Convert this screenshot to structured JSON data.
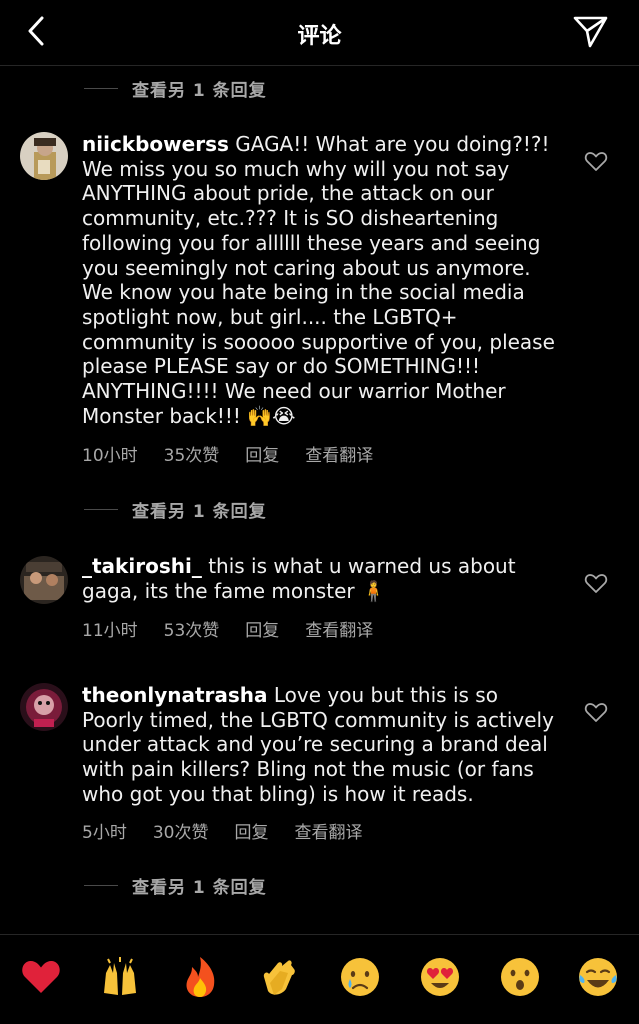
{
  "header": {
    "title": "评论"
  },
  "view_more_replies": "查看另 1 条回复",
  "comments": [
    {
      "username": "niickbowerss",
      "text": "GAGA!! What are you doing?!?! We miss you so much why will you not say ANYTHING about pride, the attack on our community, etc.??? It is SO disheartening following you for allllll these years and seeing you seemingly not caring about us anymore. We know you hate being in the social media spotlight now, but girl.... the LGBTQ+ community is sooooo supportive of you, please please PLEASE say or do SOMETHING!!! ANYTHING!!!! We need our warrior Mother Monster back!!! 🙌😭",
      "time": "10小时",
      "likes": "35次赞",
      "reply": "回复",
      "translate": "查看翻译"
    },
    {
      "username": "_takiroshi_",
      "text": "this is what u warned us about gaga, its the fame monster 🧍",
      "time": "11小时",
      "likes": "53次赞",
      "reply": "回复",
      "translate": "查看翻译"
    },
    {
      "username": "theonlynatrasha",
      "text": "Love you but this is so Poorly timed, the LGBTQ community is actively under attack and you’re securing a brand deal with pain killers? Bling not the music (or fans who got you that bling) is how it reads.",
      "time": "5小时",
      "likes": "30次赞",
      "reply": "回复",
      "translate": "查看翻译"
    }
  ],
  "emoji_bar": [
    "red-heart",
    "raising-hands",
    "fire",
    "clapping-hands",
    "crying-face",
    "heart-eyes",
    "astonished-face",
    "tears-of-joy"
  ]
}
